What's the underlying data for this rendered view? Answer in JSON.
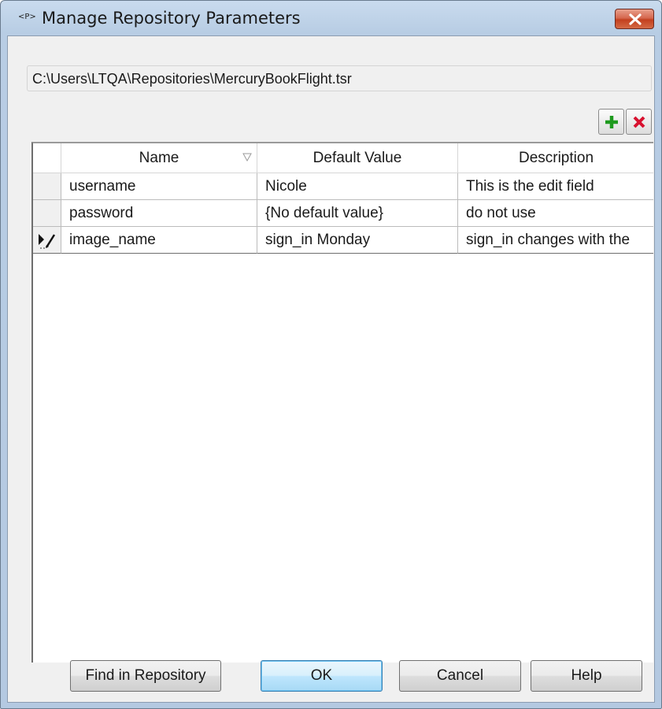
{
  "window": {
    "title_icon": "<P>",
    "title": "Manage Repository Parameters",
    "close_icon": "close-icon"
  },
  "repository_path": "C:\\Users\\LTQA\\Repositories\\MercuryBookFlight.tsr",
  "toolbar": {
    "add_icon": "plus-icon",
    "add_color": "#1e9a1e",
    "delete_icon": "x-icon",
    "delete_color": "#d8112f"
  },
  "grid": {
    "columns": [
      "Name",
      "Default Value",
      "Description"
    ],
    "sorted_column": "Name",
    "rows": [
      {
        "name": "username",
        "default_value": "Nicole",
        "description": "This is the edit field",
        "current": false
      },
      {
        "name": "password",
        "default_value": "{No default value}",
        "description": "do not use",
        "current": false
      },
      {
        "name": "image_name",
        "default_value": "sign_in Monday",
        "description": "sign_in changes with the",
        "current": true
      }
    ]
  },
  "buttons": {
    "find": "Find in Repository",
    "ok": "OK",
    "cancel": "Cancel",
    "help": "Help"
  }
}
